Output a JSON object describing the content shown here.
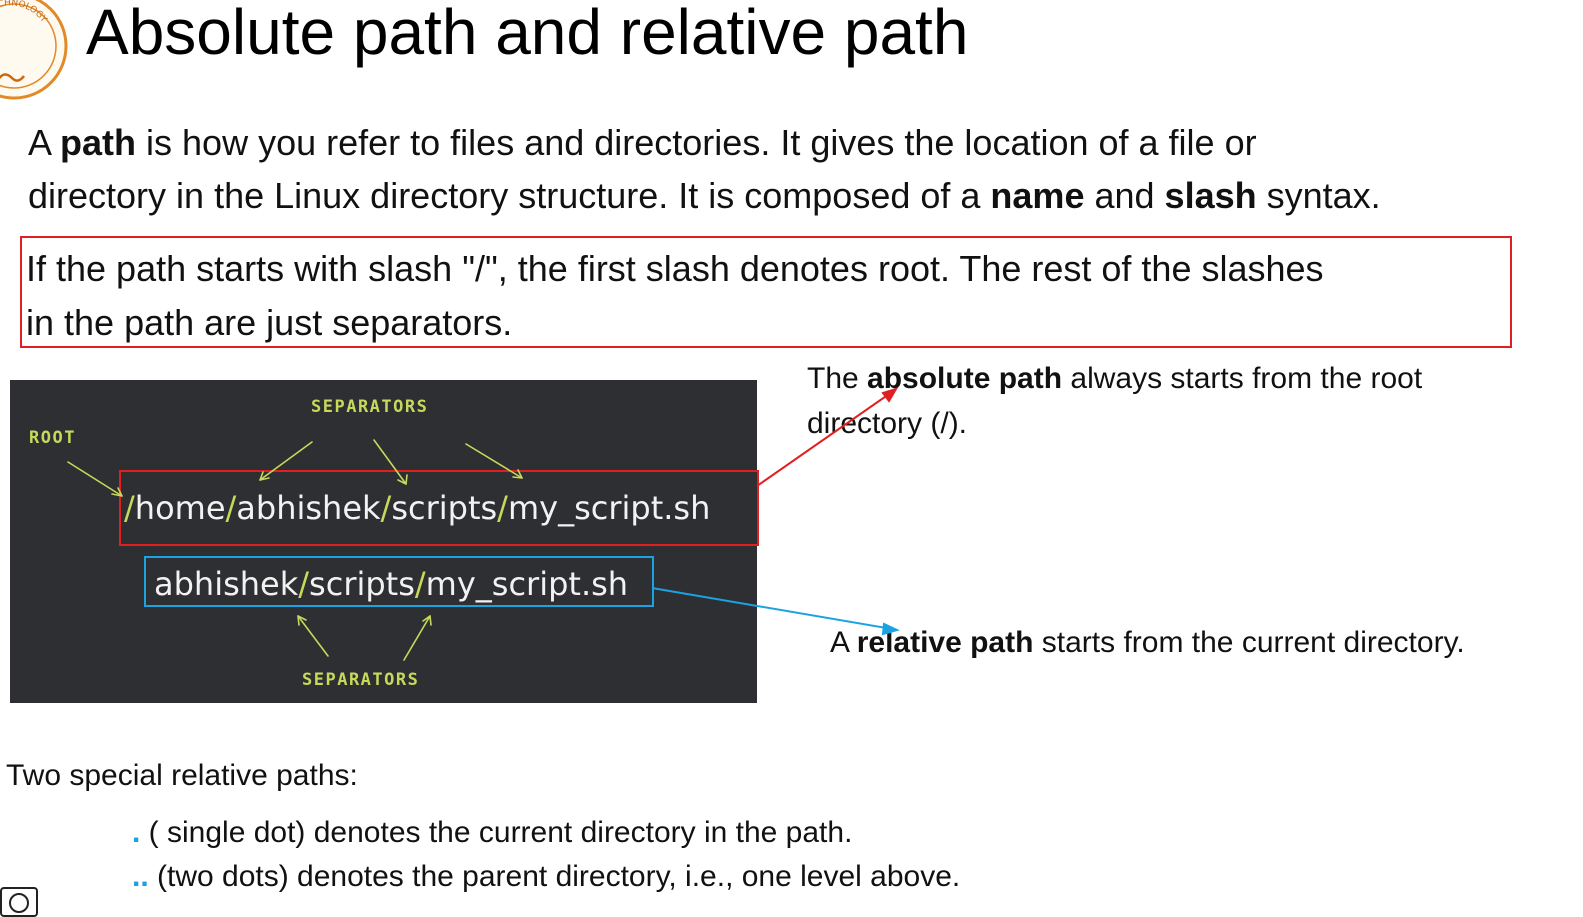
{
  "slide": {
    "title": "Absolute path and relative path",
    "intro": {
      "p1": "A ",
      "b1": "path",
      "p2": " is how you refer to files and directories. It gives the location of a file or",
      "p3": "directory in the Linux directory structure. It is composed of a ",
      "b2": "name",
      "p4": " and ",
      "b3": "slash",
      "p5": " syntax."
    },
    "rule": {
      "line1": "If the path starts with slash \"/\", the first slash denotes root. The rest of the slashes",
      "line2": "in the path are just separators."
    }
  },
  "diagram": {
    "label_separators_top": "SEPARATORS",
    "label_root": "ROOT",
    "label_separators_bottom": "SEPARATORS",
    "absolute_path": {
      "s1": "/",
      "seg1": "home",
      "s2": "/",
      "seg2": "abhishek",
      "s3": "/",
      "seg3": "scripts",
      "s4": "/",
      "seg4": "my_script.sh"
    },
    "relative_path": {
      "seg1": "abhishek",
      "s1": "/",
      "seg2": "scripts",
      "s2": "/",
      "seg3": "my_script.sh"
    },
    "colors": {
      "panel_bg": "#2e2f33",
      "separator": "#c8d85a",
      "absolute_highlight": "#e02020",
      "relative_highlight": "#1aa3e0"
    }
  },
  "callouts": {
    "absolute": {
      "p1": "The ",
      "b1": "absolute path",
      "p2": " always starts from the root directory (/)."
    },
    "relative": {
      "p1": "A ",
      "b1": "relative path",
      "p2": " starts from the current directory."
    }
  },
  "special": {
    "heading": "Two special relative paths:",
    "items": [
      {
        "marker": ".",
        "text": " ( single dot) denotes the current directory in the path."
      },
      {
        "marker": "..",
        "text": " (two dots) denotes the parent directory, i.e., one level above."
      }
    ]
  },
  "icons": {
    "logo": "university-seal-icon",
    "logo_text": "TECHNOLOGY",
    "license": "creative-commons-icon"
  }
}
